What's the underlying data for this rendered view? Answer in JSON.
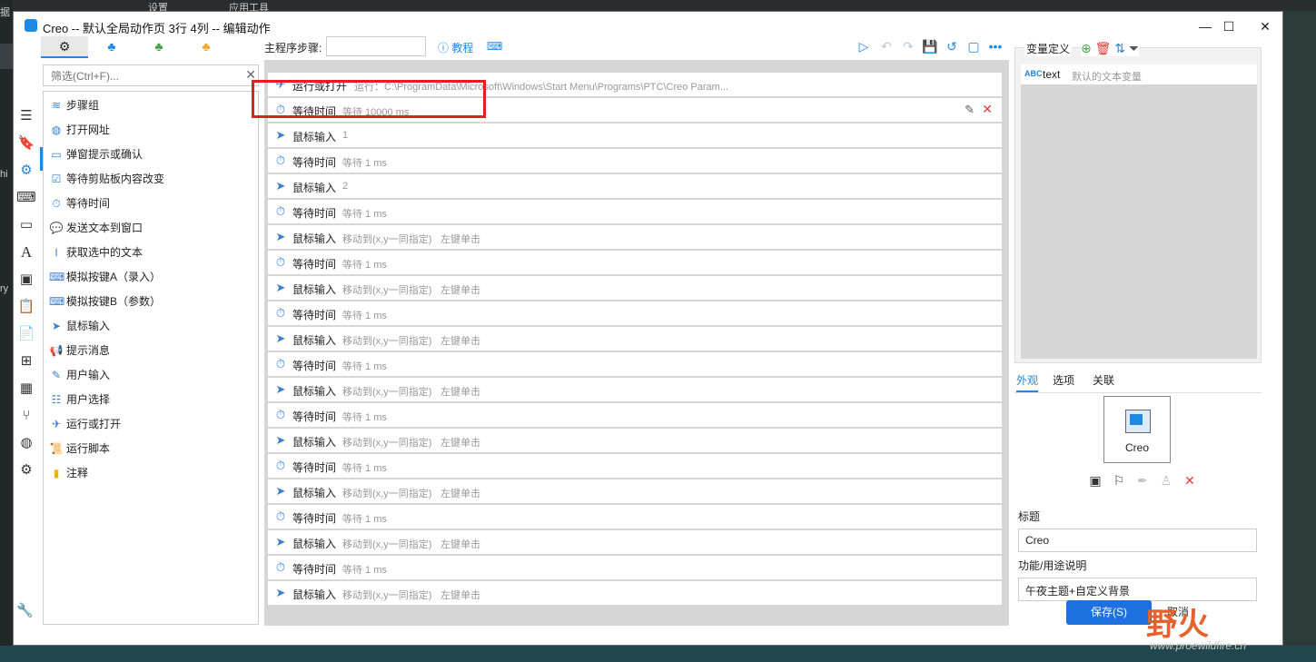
{
  "background": {
    "top_items": [
      "设置",
      "应用工具"
    ],
    "left_items": [
      "据",
      "hi",
      "ry"
    ]
  },
  "window": {
    "title": "Creo -- 默认全局动作页 3行 4列 -- 编辑动作",
    "controls": [
      "minimize",
      "maximize",
      "close"
    ]
  },
  "tabs": {
    "icons": [
      "gears-icon",
      "cluster-blue-icon",
      "cluster-green-icon",
      "cluster-orange-icon"
    ],
    "active_index": 0
  },
  "filter": {
    "placeholder": "筛选(Ctrl+F)..."
  },
  "left_nav": {
    "icons": [
      "menu-icon",
      "bookmark-icon",
      "gear-icon",
      "keyboard-icon",
      "window-icon",
      "font-icon",
      "image-icon",
      "clipboard-icon",
      "document-icon",
      "windows-icon",
      "calculator-icon",
      "branch-icon",
      "globe-icon",
      "gears-icon"
    ],
    "active_index": 2
  },
  "actions": [
    {
      "label": "步骤组",
      "icon": "layers-icon"
    },
    {
      "label": "打开网址",
      "icon": "globe-icon"
    },
    {
      "label": "弹窗提示或确认",
      "icon": "dialog-icon"
    },
    {
      "label": "等待剪贴板内容改变",
      "icon": "clipboard-check-icon"
    },
    {
      "label": "等待时间",
      "icon": "timer-icon"
    },
    {
      "label": "发送文本到窗口",
      "icon": "message-icon"
    },
    {
      "label": "获取选中的文本",
      "icon": "text-cursor-icon"
    },
    {
      "label": "模拟按键A（录入）",
      "icon": "keyboard-icon"
    },
    {
      "label": "模拟按键B（参数）",
      "icon": "keyboard-icon"
    },
    {
      "label": "鼠标输入",
      "icon": "cursor-icon"
    },
    {
      "label": "提示消息",
      "icon": "megaphone-icon"
    },
    {
      "label": "用户输入",
      "icon": "user-input-icon"
    },
    {
      "label": "用户选择",
      "icon": "list-icon"
    },
    {
      "label": "运行或打开",
      "icon": "paper-plane-icon"
    },
    {
      "label": "运行脚本",
      "icon": "script-icon"
    },
    {
      "label": "注释",
      "icon": "note-icon"
    }
  ],
  "toolbar": {
    "step_label": "主程序步骤:",
    "step_value": "",
    "tutorial": "教程",
    "icons": [
      "play-icon",
      "undo-icon",
      "redo-icon",
      "save-icon",
      "history-icon",
      "note-icon",
      "more-icon"
    ]
  },
  "steps": [
    {
      "name": "运行或打开",
      "d1": "运行：C:\\ProgramData\\Microsoft\\Windows\\Start Menu\\Programs\\PTC\\Creo Param...",
      "d2": "",
      "icon": "paper-plane-icon"
    },
    {
      "name": "等待时间",
      "d1": "等待 10000 ms",
      "d2": "",
      "icon": "timer-icon",
      "selected": true
    },
    {
      "name": "鼠标输入",
      "d1": "1",
      "d2": "",
      "icon": "cursor-icon"
    },
    {
      "name": "等待时间",
      "d1": "等待 1 ms",
      "d2": "",
      "icon": "timer-icon"
    },
    {
      "name": "鼠标输入",
      "d1": "2",
      "d2": "",
      "icon": "cursor-icon"
    },
    {
      "name": "等待时间",
      "d1": "等待 1 ms",
      "d2": "",
      "icon": "timer-icon"
    },
    {
      "name": "鼠标输入",
      "d1": "移动到(x,y一同指定)",
      "d2": "左键单击",
      "icon": "cursor-icon"
    },
    {
      "name": "等待时间",
      "d1": "等待 1 ms",
      "d2": "",
      "icon": "timer-icon"
    },
    {
      "name": "鼠标输入",
      "d1": "移动到(x,y一同指定)",
      "d2": "左键单击",
      "icon": "cursor-icon"
    },
    {
      "name": "等待时间",
      "d1": "等待 1 ms",
      "d2": "",
      "icon": "timer-icon"
    },
    {
      "name": "鼠标输入",
      "d1": "移动到(x,y一同指定)",
      "d2": "左键单击",
      "icon": "cursor-icon"
    },
    {
      "name": "等待时间",
      "d1": "等待 1 ms",
      "d2": "",
      "icon": "timer-icon"
    },
    {
      "name": "鼠标输入",
      "d1": "移动到(x,y一同指定)",
      "d2": "左键单击",
      "icon": "cursor-icon"
    },
    {
      "name": "等待时间",
      "d1": "等待 1 ms",
      "d2": "",
      "icon": "timer-icon"
    },
    {
      "name": "鼠标输入",
      "d1": "移动到(x,y一同指定)",
      "d2": "左键单击",
      "icon": "cursor-icon"
    },
    {
      "name": "等待时间",
      "d1": "等待 1 ms",
      "d2": "",
      "icon": "timer-icon"
    },
    {
      "name": "鼠标输入",
      "d1": "移动到(x,y一同指定)",
      "d2": "左键单击",
      "icon": "cursor-icon"
    },
    {
      "name": "等待时间",
      "d1": "等待 1 ms",
      "d2": "",
      "icon": "timer-icon"
    },
    {
      "name": "鼠标输入",
      "d1": "移动到(x,y一同指定)",
      "d2": "左键单击",
      "icon": "cursor-icon"
    },
    {
      "name": "等待时间",
      "d1": "等待 1 ms",
      "d2": "",
      "icon": "timer-icon"
    },
    {
      "name": "鼠标输入",
      "d1": "移动到(x,y一同指定)",
      "d2": "左键单击",
      "icon": "cursor-icon"
    }
  ],
  "variables": {
    "header": "变量定义",
    "header_icons": [
      "add-icon",
      "delete-icon",
      "sort-icon",
      "filter-icon"
    ],
    "items": [
      {
        "type": "ABC",
        "name": "text",
        "desc": "默认的文本变量"
      }
    ]
  },
  "right_tabs": {
    "labels": [
      "外观",
      "选项",
      "关联"
    ],
    "active_index": 0
  },
  "appearance": {
    "preview_name": "Creo",
    "icons": [
      "image-icon",
      "flag-icon",
      "eyedropper-icon",
      "shirt-icon",
      "close-icon"
    ],
    "title_label": "标题",
    "title_value": "Creo",
    "desc_label": "功能/用途说明",
    "desc_value": "午夜主题+自定义背景"
  },
  "buttons": {
    "save": "保存(S)",
    "cancel": "取消"
  },
  "watermark": {
    "text_a": "野火",
    "text_b": "论坛",
    "url": "www.proewildfire.cn"
  },
  "colors": {
    "accent": "#1e88e5",
    "delete": "#e53935",
    "highlight": "#e02020"
  }
}
